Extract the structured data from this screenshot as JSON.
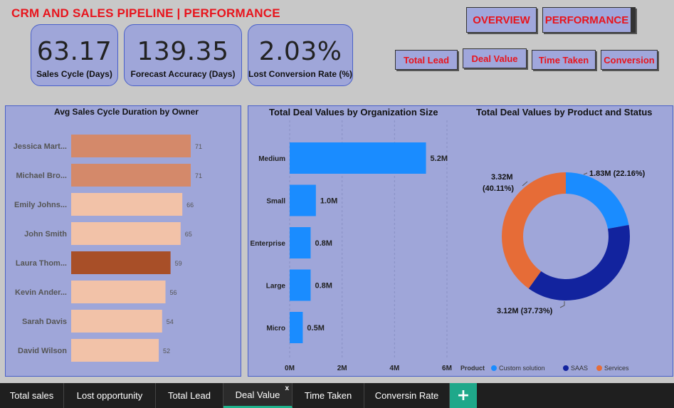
{
  "header": {
    "title": "CRM AND SALES PIPELINE | PERFORMANCE"
  },
  "kpis": [
    {
      "value": "63.17",
      "label": "Sales Cycle (Days)"
    },
    {
      "value": "139.35",
      "label": "Forecast Accuracy (Days)"
    },
    {
      "value": "2.03%",
      "label": "Lost Conversion Rate (%)"
    }
  ],
  "nav": {
    "overview": "OVERVIEW",
    "performance": "PERFORMANCE",
    "total_lead": "Total Lead",
    "deal_value": "Deal Value",
    "time_taken": "Time Taken",
    "conversion": "Conversion"
  },
  "chart_data": [
    {
      "type": "bar",
      "orientation": "horizontal",
      "title": "Avg Sales Cycle Duration by Owner",
      "categories": [
        "Jessica Mart...",
        "Michael Bro...",
        "Emily Johns...",
        "John Smith",
        "Laura Thom...",
        "Kevin Ander...",
        "Sarah Davis",
        "David Wilson"
      ],
      "values": [
        71,
        71,
        66,
        65,
        59,
        56,
        54,
        52
      ],
      "colors": [
        "#d4896a",
        "#d4896a",
        "#f2c2a8",
        "#f2c2a8",
        "#a84f28",
        "#f2c2a8",
        "#f2c2a8",
        "#f2c2a8"
      ]
    },
    {
      "type": "bar",
      "orientation": "horizontal",
      "title": "Total Deal Values by Organization Size",
      "categories": [
        "Medium",
        "Small",
        "Enterprise",
        "Large",
        "Micro"
      ],
      "values": [
        5.2,
        1.0,
        0.8,
        0.8,
        0.5
      ],
      "data_labels": [
        "5.2M",
        "1.0M",
        "0.8M",
        "0.8M",
        "0.5M"
      ],
      "xticks": [
        "0M",
        "2M",
        "4M",
        "6M"
      ],
      "xlim": [
        0,
        6
      ],
      "color": "#1a8cff",
      "grid": true
    },
    {
      "type": "pie",
      "donut": true,
      "title": "Total Deal Values by Product and Status",
      "legend_title": "Product",
      "legend_position": "bottom",
      "slices": [
        {
          "name": "Custom solution",
          "value": 1.83,
          "label": "1.83M (22.16%)",
          "color": "#1a8cff"
        },
        {
          "name": "SAAS",
          "value": 3.12,
          "label": "3.12M (37.73%)",
          "color": "#12239e"
        },
        {
          "name": "Services",
          "value": 3.32,
          "label_line1": "3.32M",
          "label_line2": "(40.11%)",
          "color": "#e66c37"
        }
      ]
    }
  ],
  "tabs": [
    {
      "label": "Total sales",
      "active": false
    },
    {
      "label": "Lost opportunity",
      "active": false
    },
    {
      "label": "Total Lead",
      "active": false
    },
    {
      "label": "Deal Value",
      "active": true,
      "close": "x"
    },
    {
      "label": "Time Taken",
      "active": false
    },
    {
      "label": "Conversin Rate",
      "active": false
    }
  ],
  "add_tab": "+"
}
